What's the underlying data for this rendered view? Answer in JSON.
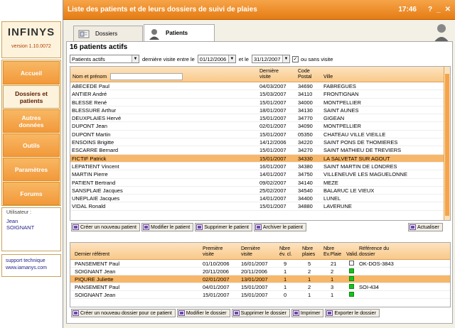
{
  "sidebar": {
    "brand": "INFINYS",
    "version": "version 1.10.0072",
    "nav": [
      {
        "label": "Accueil"
      },
      {
        "label": "Dossiers et patients"
      },
      {
        "label": "Autres données"
      },
      {
        "label": "Outils"
      },
      {
        "label": "Paramètres"
      },
      {
        "label": "Forums"
      }
    ],
    "user_label": "Utilisateur :",
    "user_first": "Jean",
    "user_last": "SOIGNANT",
    "support": "support technique",
    "site": "www.iamanys.com"
  },
  "window": {
    "title": "Liste des patients et de leurs dossiers de suivi de plaies",
    "time": "17:46",
    "controls": [
      "?",
      "_",
      "✕"
    ]
  },
  "tabs": [
    {
      "label": "Dossiers"
    },
    {
      "label": "Patients"
    }
  ],
  "patients": {
    "title": "16 patients actifs",
    "filter": {
      "status": "Patients actifs",
      "visit_between": "dernière visite entre le",
      "date_from": "01/12/2006",
      "and": "et le",
      "date_to": "31/12/2007",
      "no_visit": "ou sans visite"
    },
    "columns": {
      "name": "Nom et prénom",
      "last_visit": "Dernière visite",
      "postal": "Code Postal",
      "city": "Ville"
    },
    "rows": [
      {
        "name": "ABECEDE Paul",
        "date": "04/03/2007",
        "cp": "34690",
        "city": "FABREGUES"
      },
      {
        "name": "ANTIER André",
        "date": "15/03/2007",
        "cp": "34110",
        "city": "FRONTIGNAN"
      },
      {
        "name": "BLESSE René",
        "date": "15/01/2007",
        "cp": "34000",
        "city": "MONTPELLIER"
      },
      {
        "name": "BLESSURE Arthur",
        "date": "18/01/2007",
        "cp": "34130",
        "city": "SAINT AUNES"
      },
      {
        "name": "DEUXPLAIES Hervé",
        "date": "15/01/2007",
        "cp": "34770",
        "city": "GIGEAN"
      },
      {
        "name": "DUPONT Jean",
        "date": "02/01/2007",
        "cp": "34090",
        "city": "MONTPELLIER"
      },
      {
        "name": "DUPONT Martin",
        "date": "15/01/2007",
        "cp": "05350",
        "city": "CHATEAU VILLE VIEILLE"
      },
      {
        "name": "ENSOINS Brigitte",
        "date": "14/12/2006",
        "cp": "34220",
        "city": "SAINT PONS DE THOMIERES"
      },
      {
        "name": "ESCARRE Bernard",
        "date": "15/01/2007",
        "cp": "34270",
        "city": "SAINT MATHIEU DE TREVIERS"
      },
      {
        "name": "FICTIF Patrick",
        "date": "15/01/2007",
        "cp": "34330",
        "city": "LA SALVETAT SUR AGOUT"
      },
      {
        "name": "LEPATIENT Vincent",
        "date": "16/01/2007",
        "cp": "34380",
        "city": "SAINT MARTIN DE LONDRES"
      },
      {
        "name": "MARTIN Pierre",
        "date": "14/01/2007",
        "cp": "34750",
        "city": "VILLENEUVE LES MAGUELONNE"
      },
      {
        "name": "PATIENT Bertrand",
        "date": "09/02/2007",
        "cp": "34140",
        "city": "MEZE"
      },
      {
        "name": "SANSPLAIE Jacques",
        "date": "25/02/2007",
        "cp": "34540",
        "city": "BALARUC LE VIEUX"
      },
      {
        "name": "UNEPLAIE Jacques",
        "date": "14/01/2007",
        "cp": "34400",
        "city": "LUNEL"
      },
      {
        "name": "VIDAL Ronald",
        "date": "15/01/2007",
        "cp": "34880",
        "city": "LAVERUNE"
      }
    ],
    "buttons": {
      "create": "Créer un nouveau patient",
      "edit": "Modifier le patient",
      "delete": "Supprimer le patient",
      "archive": "Archiver le patient",
      "refresh": "Actualiser"
    }
  },
  "dossiers": {
    "columns": {
      "referent": "Dernier référent",
      "first": "Première visite",
      "last": "Dernière visite",
      "ev": "Nbre év. cl.",
      "plaies": "Nbre plaies",
      "evp": "Nbre Ev.Plaie",
      "valid": "Valid.",
      "ref": "Référence du dossier"
    },
    "rows": [
      {
        "referent": "PANSEMENT Paul",
        "first": "01/10/2006",
        "last": "16/01/2007",
        "ev": "9",
        "pl": "5",
        "evp": "21",
        "valid": false,
        "ref": "OK-DOS-3843"
      },
      {
        "referent": "SOIGNANT Jean",
        "first": "20/11/2006",
        "last": "20/11/2006",
        "ev": "1",
        "pl": "2",
        "evp": "2",
        "valid": true,
        "ref": ""
      },
      {
        "referent": "PIQURE Juliette",
        "first": "02/01/2007",
        "last": "13/01/2007",
        "ev": "1",
        "pl": "1",
        "evp": "1",
        "valid": true,
        "ref": ""
      },
      {
        "referent": "PANSEMENT Paul",
        "first": "04/01/2007",
        "last": "15/01/2007",
        "ev": "1",
        "pl": "2",
        "evp": "3",
        "valid": true,
        "ref": "SOI-434"
      },
      {
        "referent": "SOIGNANT Jean",
        "first": "15/01/2007",
        "last": "15/01/2007",
        "ev": "0",
        "pl": "1",
        "evp": "1",
        "valid": true,
        "ref": ""
      }
    ],
    "buttons": {
      "create": "Créer un nouveau dossier pour ce patient",
      "edit": "Modifier le dossier",
      "delete": "Supprimer le dossier",
      "print": "Imprimer",
      "export": "Exporter le dossier"
    }
  },
  "colors": {
    "accent": "#f2993a",
    "selection": "#f7b76a",
    "valid": "#19c01e"
  }
}
